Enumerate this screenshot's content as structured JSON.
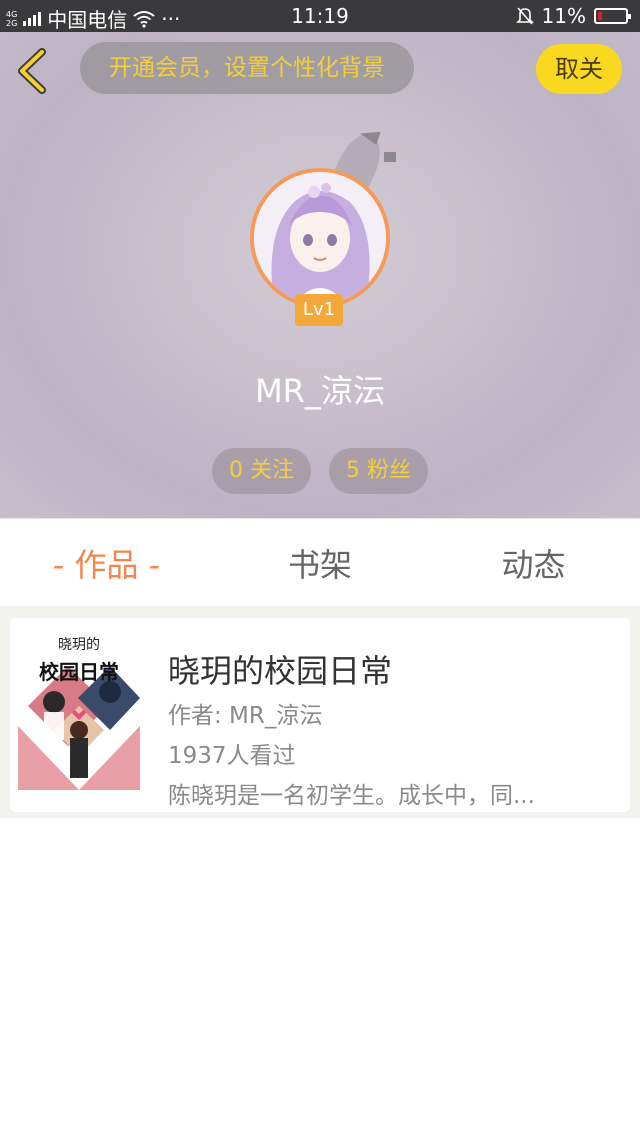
{
  "status_bar": {
    "net_top": "4G",
    "net_bottom": "2G",
    "carrier": "中国电信",
    "more": "···",
    "time": "11:19",
    "battery": "11%"
  },
  "header": {
    "vip_banner": "开通会员，设置个性化背景",
    "unfollow_label": "取关",
    "level": "Lv1",
    "username": "MR_涼沄",
    "following": "0 关注",
    "fans": "5 粉丝"
  },
  "tabs": [
    {
      "label": "- 作品 -",
      "active": true
    },
    {
      "label": "书架",
      "active": false
    },
    {
      "label": "动态",
      "active": false
    }
  ],
  "books": [
    {
      "cover_small": "晓玥的",
      "cover_big": "校园日常",
      "title": "晓玥的校园日常",
      "author": "作者: MR_涼沄",
      "views": "1937人看过",
      "description": "陈晓玥是一名初学生。成长中，同..."
    }
  ],
  "colors": {
    "accent_orange": "#f5854a",
    "accent_yellow": "#f9d920",
    "banner_text": "#f4cf3a"
  }
}
